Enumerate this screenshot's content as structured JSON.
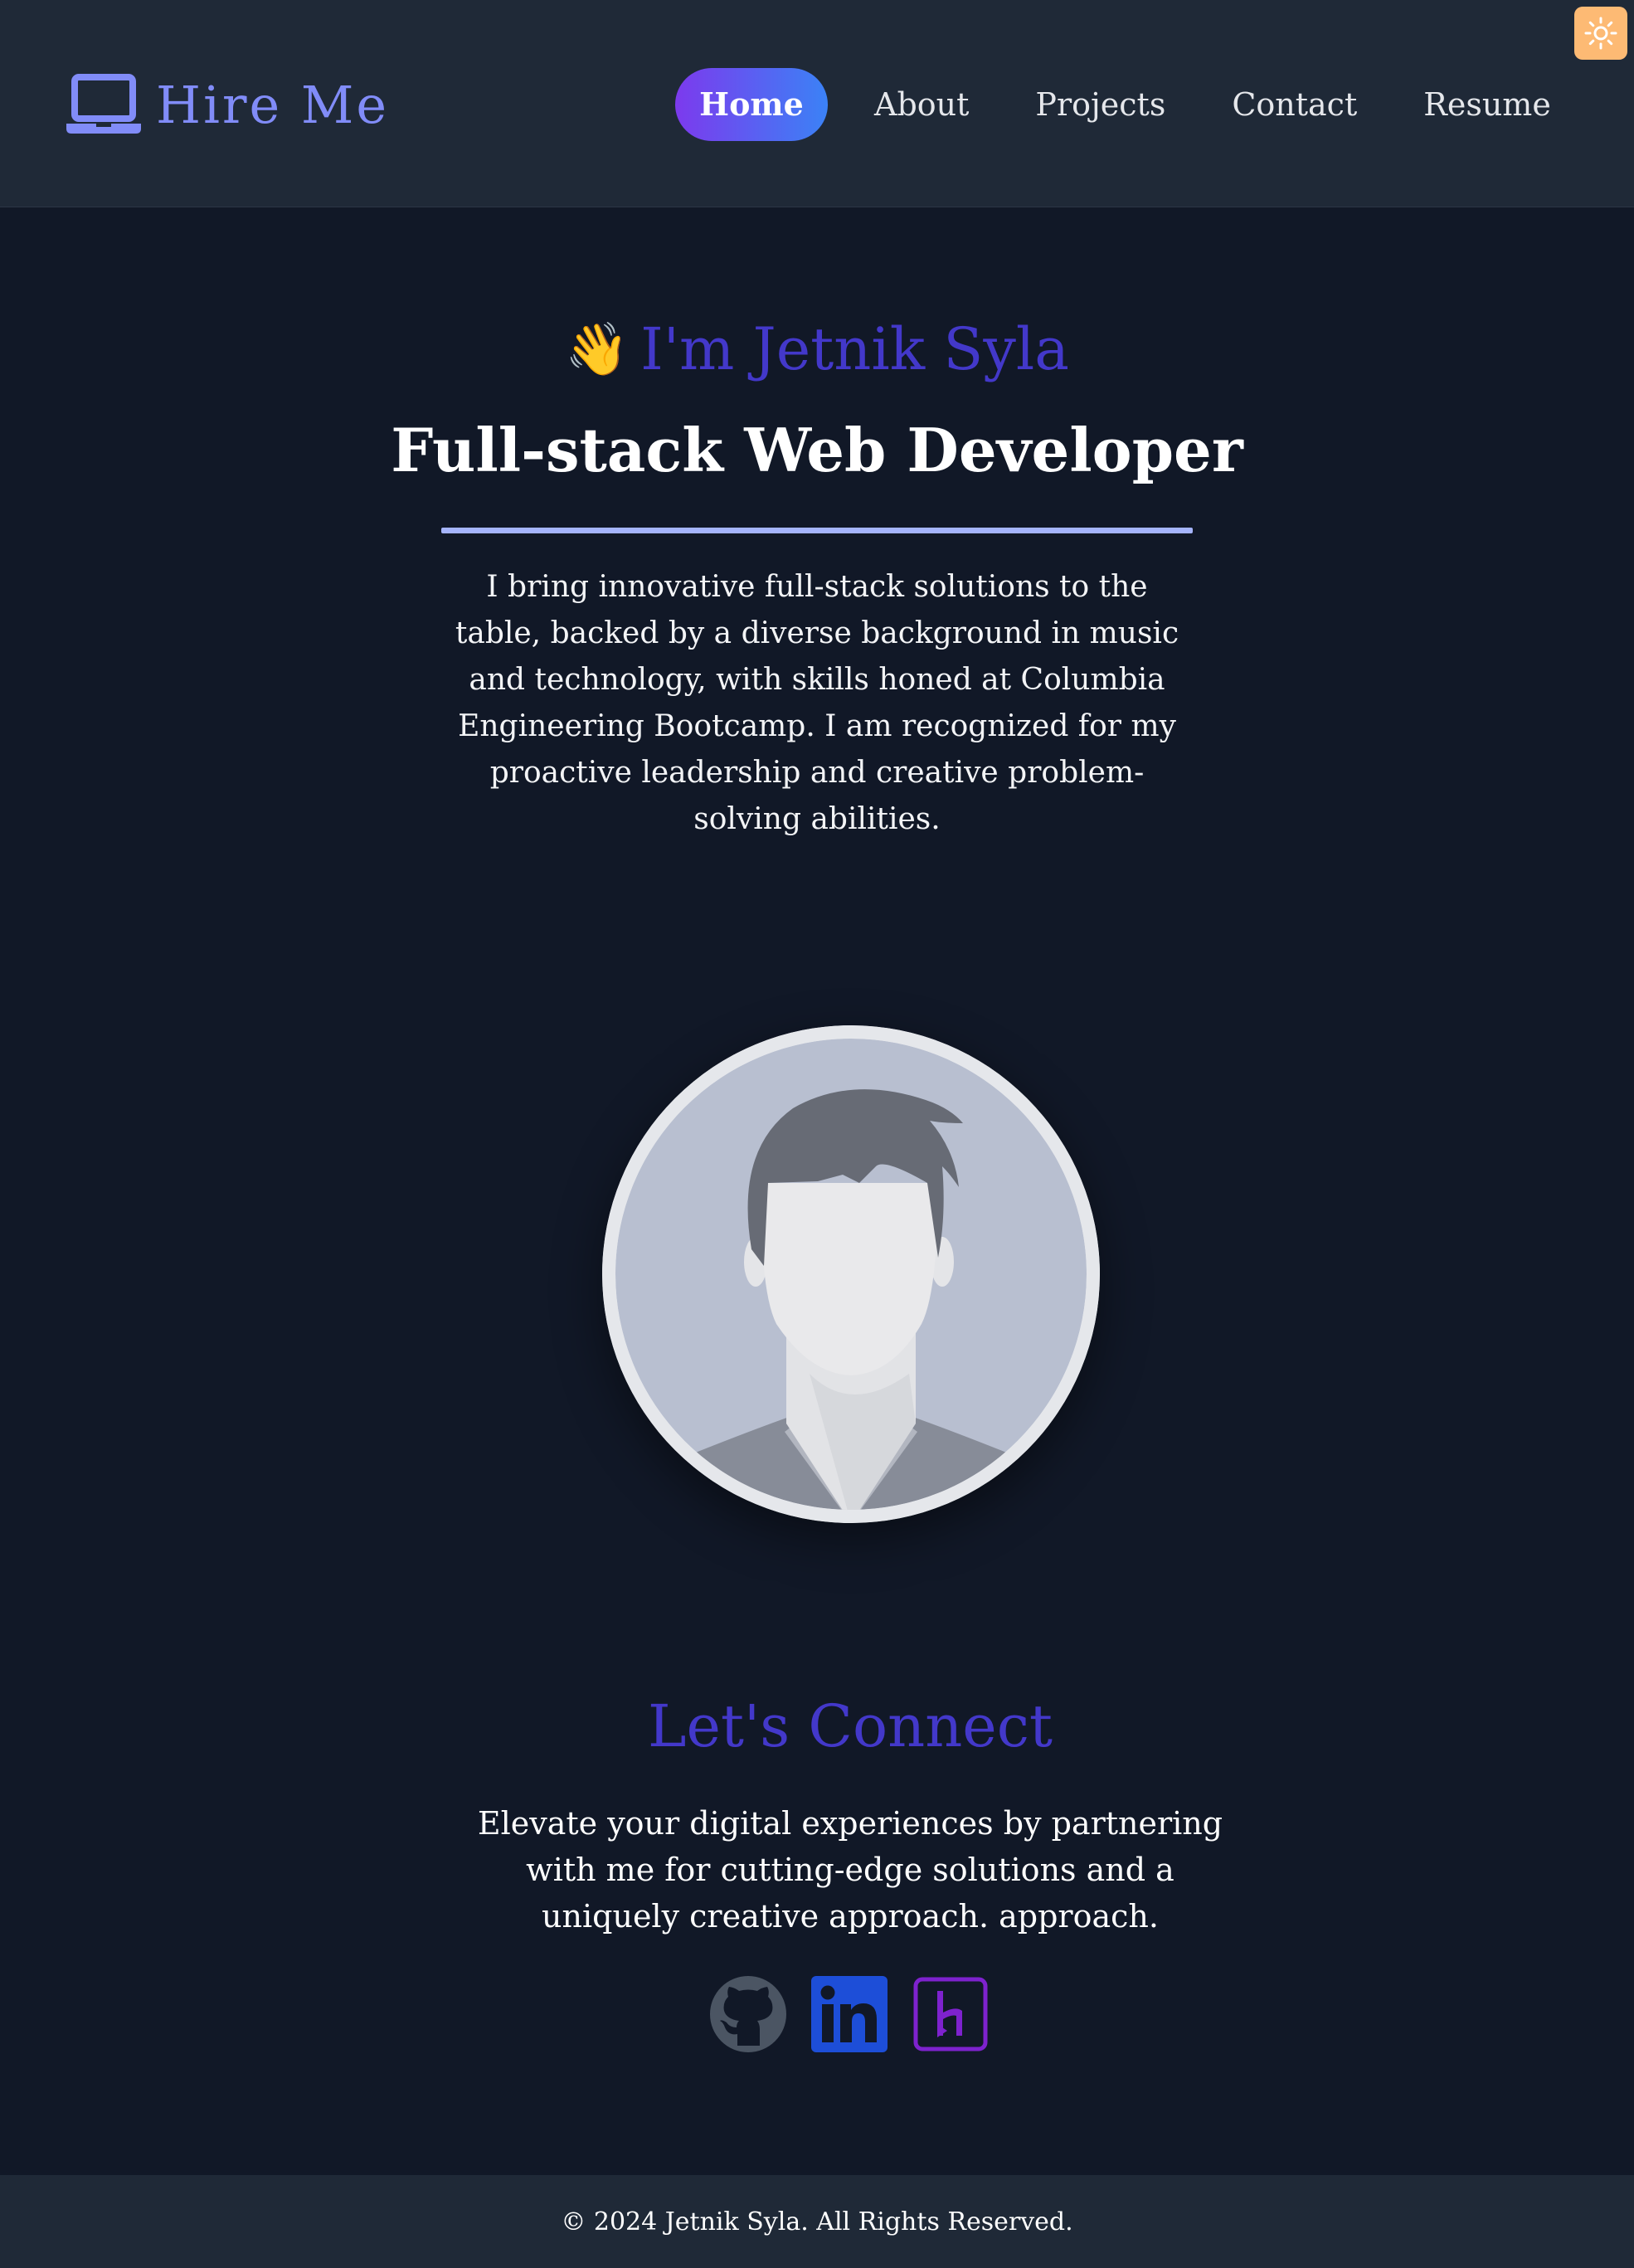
{
  "header": {
    "logo_text": "Hire Me",
    "nav": [
      {
        "label": "Home",
        "active": true
      },
      {
        "label": "About"
      },
      {
        "label": "Projects"
      },
      {
        "label": "Contact"
      },
      {
        "label": "Resume"
      }
    ],
    "theme_icon": "sun-icon"
  },
  "hero": {
    "wave_emoji": "👋",
    "greeting": "I'm Jetnik Syla",
    "title": "Full-stack Web Developer",
    "bio": "I bring innovative full-stack solutions to the table, backed by a diverse background in music and technology, with skills honed at Columbia Engineering Bootcamp. I am recognized for my proactive leadership and creative problem-solving abilities."
  },
  "connect": {
    "title": "Let's Connect",
    "text": "Elevate your digital experiences by partnering with me for cutting-edge solutions and a uniquely creative approach. approach.",
    "socials": [
      {
        "icon": "github-icon"
      },
      {
        "icon": "linkedin-icon"
      },
      {
        "icon": "heroku-icon"
      }
    ]
  },
  "footer": {
    "copyright": "© 2024 Jetnik Syla. All Rights Reserved."
  },
  "colors": {
    "accent": "#4338ca",
    "logo": "#818cf8",
    "divider": "#a5b4fc",
    "background": "#111827",
    "header": "#1f2937",
    "toggle": "#fdba74"
  }
}
